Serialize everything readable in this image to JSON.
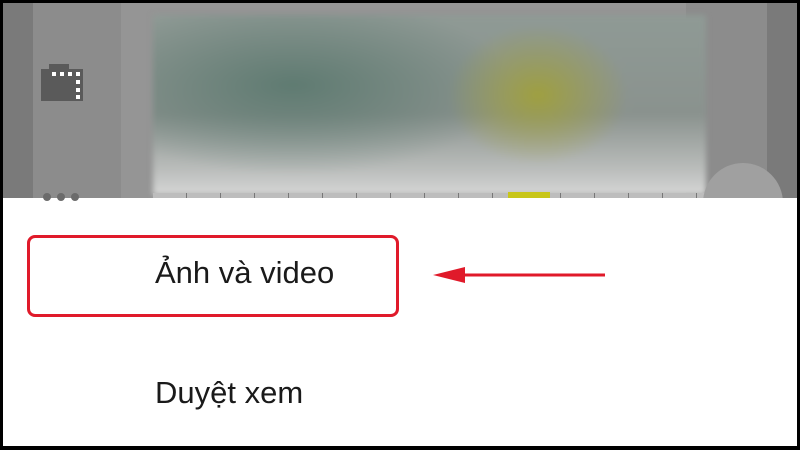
{
  "sheet": {
    "items": [
      {
        "label": "Ảnh và video",
        "icon": "film-icon"
      },
      {
        "label": "Duyệt xem",
        "icon": "more-dots-icon"
      }
    ]
  },
  "annotation": {
    "highlight_color": "#e01a2a"
  }
}
